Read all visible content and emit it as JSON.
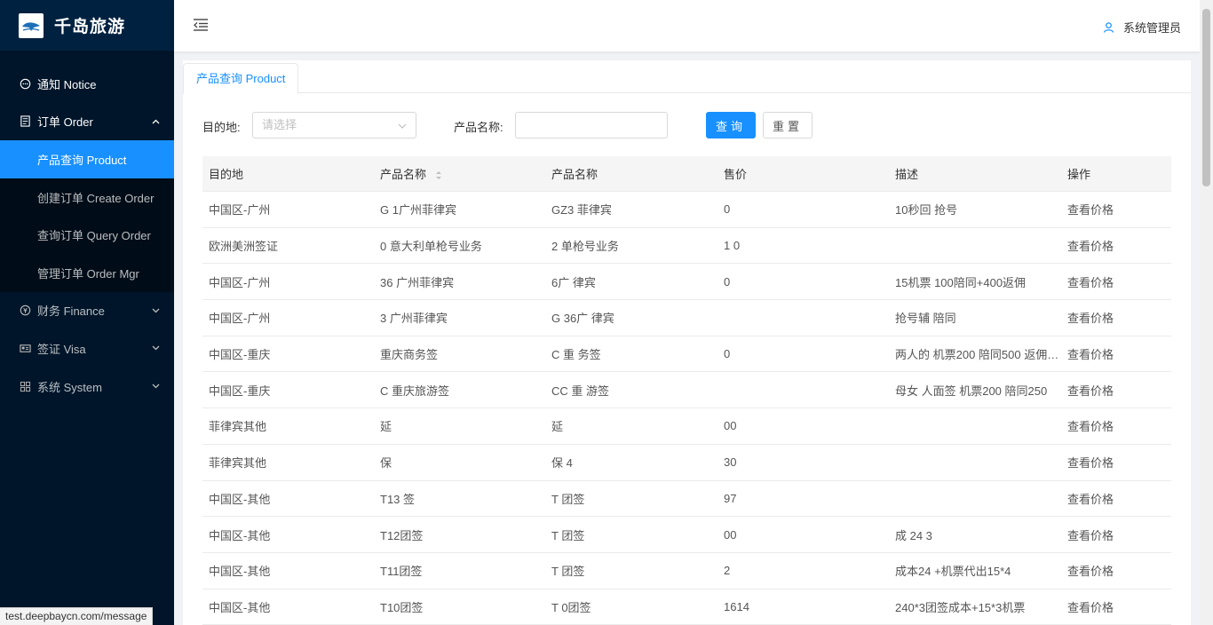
{
  "brand": {
    "name": "千岛旅游"
  },
  "sidebar": {
    "items": [
      {
        "label": "通知 Notice",
        "icon": "bell-icon"
      },
      {
        "label": "订单 Order",
        "icon": "order-icon",
        "expanded": true,
        "children": [
          {
            "label": "产品查询 Product",
            "active": true
          },
          {
            "label": "创建订单 Create Order"
          },
          {
            "label": "查询订单 Query Order"
          },
          {
            "label": "管理订单 Order Mgr"
          }
        ]
      },
      {
        "label": "财务 Finance",
        "icon": "finance-icon"
      },
      {
        "label": "签证 Visa",
        "icon": "visa-icon"
      },
      {
        "label": "系统 System",
        "icon": "system-icon"
      }
    ]
  },
  "header": {
    "user": "系统管理员"
  },
  "tabs": [
    {
      "label": "产品查询 Product"
    }
  ],
  "filters": {
    "destination_label": "目的地:",
    "destination_placeholder": "请选择",
    "product_label": "产品名称:",
    "product_value": "",
    "search_button": "查询",
    "reset_button": "重置"
  },
  "table": {
    "columns": [
      "目的地",
      "产品名称",
      "产品名称",
      "售价",
      "描述",
      "操作"
    ],
    "action_label": "查看价格",
    "rows": [
      [
        "中国区-广州",
        "G  1广州菲律宾",
        "GZ3   菲律宾",
        "   0",
        "     10秒回   抢号",
        "查看价格"
      ],
      [
        "欧洲美洲签证",
        "  0 意大利单枪号业务",
        "2   单枪号业务",
        "1  0",
        "",
        "查看价格"
      ],
      [
        "中国区-广州",
        "  36 广州菲律宾",
        "  6广   律宾",
        "  0",
        "15机票 100陪同+400返佣",
        "查看价格"
      ],
      [
        "中国区-广州",
        "  3 广州菲律宾",
        "G 36广  律宾",
        "",
        "抢号辅 陪同",
        "查看价格"
      ],
      [
        "中国区-重庆",
        "  重庆商务签",
        "C  重  务签",
        "  0",
        "两人的 机票200 陪同500 返佣3...",
        "查看价格"
      ],
      [
        "中国区-重庆",
        "C  重庆旅游签",
        "CC 重  游签",
        "",
        "母女 人面签 机票200 陪同250",
        "查看价格"
      ],
      [
        "菲律宾其他",
        "延",
        "延",
        "00",
        "",
        "查看价格"
      ],
      [
        "菲律宾其他",
        "保",
        "保 4",
        "30",
        "",
        "查看价格"
      ],
      [
        "中国区-其他",
        "T13 签",
        "T 团签",
        "97",
        "",
        "查看价格"
      ],
      [
        "中国区-其他",
        "T12团签",
        "T 团签",
        "00",
        "成 24 3",
        "查看价格"
      ],
      [
        "中国区-其他",
        "T11团签",
        "T 团签",
        "2",
        "成本24  +机票代出15*4",
        "查看价格"
      ],
      [
        "中国区-其他",
        "T10团签",
        "T 0团签",
        "1614",
        "240*3团签成本+15*3机票",
        "查看价格"
      ]
    ]
  },
  "statusbar": {
    "url": "test.deepbaycn.com/message"
  },
  "colors": {
    "accent": "#1890ff",
    "sidebar_bg": "#001529",
    "submenu_bg": "#000c17"
  }
}
